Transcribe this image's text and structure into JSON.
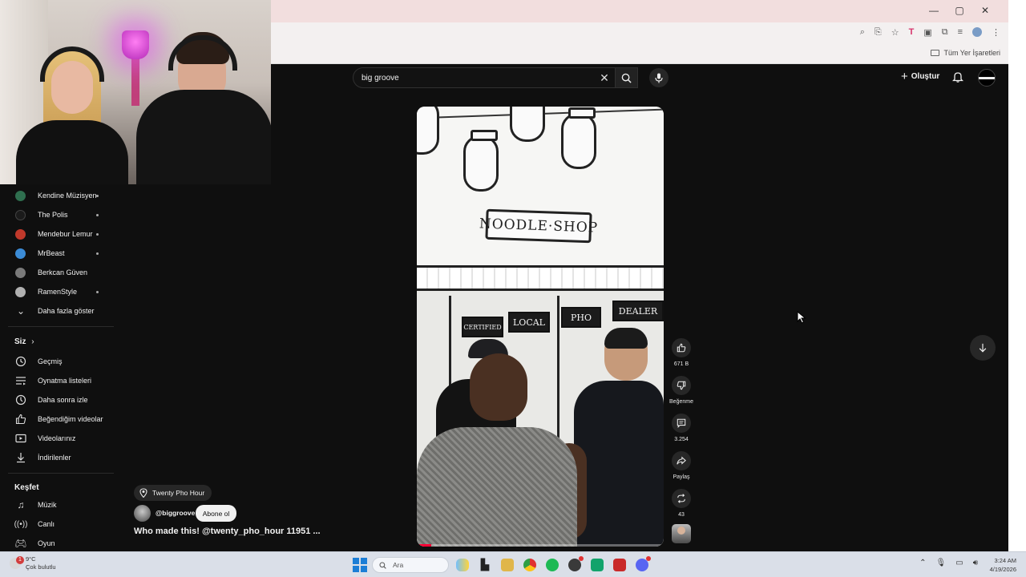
{
  "browser": {
    "window_controls": {
      "minimize": "—",
      "maximize": "▢",
      "close": "✕"
    },
    "bookmarks_all_label": "Tüm Yer İşaretleri"
  },
  "search": {
    "query": "big groove"
  },
  "header": {
    "create_label": "Oluştur"
  },
  "sidebar": {
    "subscriptions": [
      {
        "name": "Kendine Müzisyen",
        "color": "#2f6f4f",
        "new": true
      },
      {
        "name": "The Polis",
        "color": "#1b1b1b",
        "new": true
      },
      {
        "name": "Mendebur Lemur",
        "color": "#c0392b",
        "new": true
      },
      {
        "name": "MrBeast",
        "color": "#3b8bd6",
        "new": true
      },
      {
        "name": "Berkcan Güven",
        "color": "#7a7a7a",
        "new": false
      },
      {
        "name": "RamenStyle",
        "color": "#b0b0b0",
        "new": true
      }
    ],
    "show_more_label": "Daha fazla göster",
    "you_section": "Siz",
    "you_items": [
      {
        "label": "Geçmiş",
        "icon": "history-icon"
      },
      {
        "label": "Oynatma listeleri",
        "icon": "playlists-icon"
      },
      {
        "label": "Daha sonra izle",
        "icon": "watch-later-icon"
      },
      {
        "label": "Beğendiğim videolar",
        "icon": "liked-icon"
      },
      {
        "label": "Videolarınız",
        "icon": "your-videos-icon"
      },
      {
        "label": "İndirilenler",
        "icon": "downloads-icon"
      }
    ],
    "explore_section": "Keşfet",
    "explore_items": [
      {
        "label": "Müzik",
        "icon": "music-icon"
      },
      {
        "label": "Canlı",
        "icon": "live-icon"
      },
      {
        "label": "Oyun",
        "icon": "gaming-icon"
      }
    ]
  },
  "video": {
    "sign_text": "NOODLE·SHOP",
    "panels": [
      "CERTIFIED",
      "LOCAL",
      "PHO",
      "DEALER"
    ],
    "progress": 0.06,
    "progress_color": "#ff0033"
  },
  "actions": {
    "likes": "671 B",
    "dislike_label": "Beğenme",
    "comments": "3.254",
    "share_label": "Paylaş",
    "remix_count": "43"
  },
  "meta": {
    "location": "Twenty Pho Hour",
    "channel": "@biggroove",
    "subscribe_label": "Abone ol",
    "title": "Who made this! @twenty_pho_hour 11951 ..."
  },
  "taskbar": {
    "weather_badge": "1",
    "temperature": "9°C",
    "weather_desc": "Çok bulutlu",
    "search_placeholder": "Ara",
    "apps": [
      {
        "name": "file-explorer",
        "color": "#e0b64a"
      },
      {
        "name": "chrome",
        "color": "#2f9e44"
      },
      {
        "name": "spotify",
        "color": "#1db954"
      },
      {
        "name": "obs",
        "color": "#3a3a3a"
      },
      {
        "name": "app-green",
        "color": "#12a36b"
      },
      {
        "name": "app-red",
        "color": "#c92a2a"
      },
      {
        "name": "discord",
        "color": "#5865f2"
      }
    ],
    "time": "3:24 AM",
    "date": "4/19/2026"
  }
}
